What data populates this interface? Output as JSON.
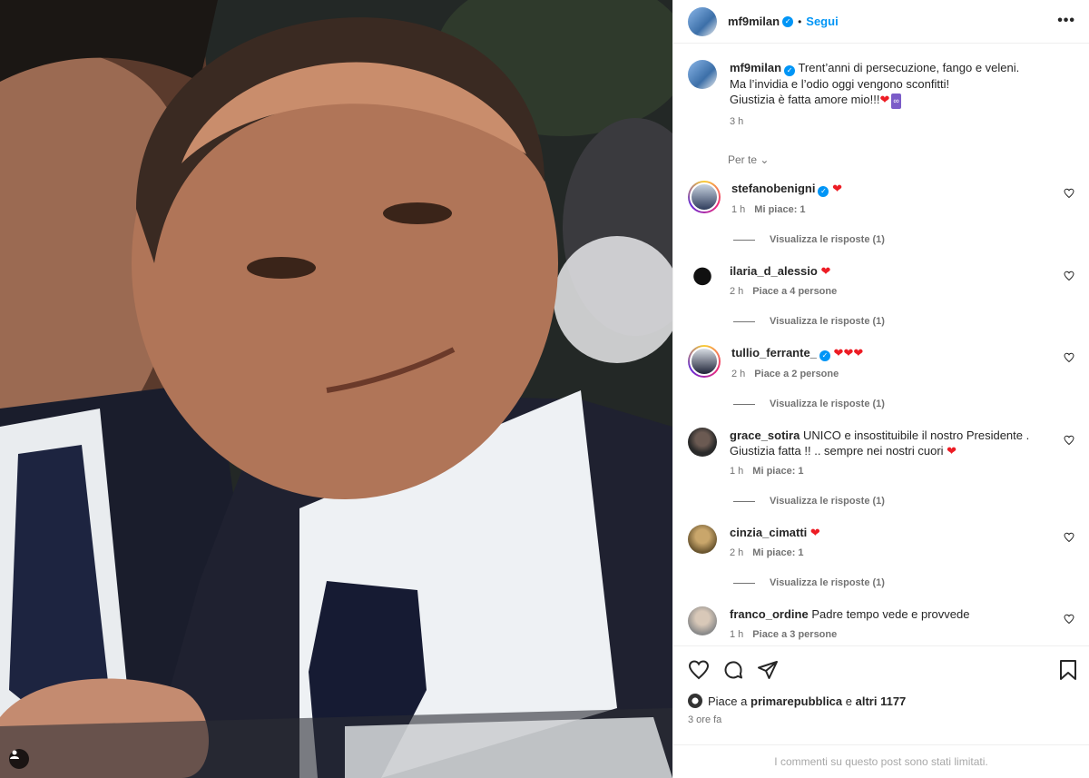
{
  "post": {
    "author": "mf9milan",
    "follow_label": "Segui",
    "more_label": "•••",
    "caption_line1": "Trent’anni di persecuzione, fango e veleni.",
    "caption_line2": "Ma l’invidia e l’odio oggi vengono sconfitti!",
    "caption_line3": "Giustizia è fatta amore mio!!!",
    "caption_time": "3 h",
    "for_you": "Per te"
  },
  "comments": [
    {
      "user": "stefanobenigni",
      "verified": true,
      "text": "",
      "hearts": 1,
      "time": "1 h",
      "likes": "Mi piace: 1",
      "replies": "Visualizza le risposte (1)"
    },
    {
      "user": "ilaria_d_alessio",
      "verified": false,
      "text": "",
      "hearts": 1,
      "time": "2 h",
      "likes": "Piace a 4 persone",
      "replies": "Visualizza le risposte (1)"
    },
    {
      "user": "tullio_ferrante_",
      "verified": true,
      "text": "",
      "hearts": 3,
      "time": "2 h",
      "likes": "Piace a 2 persone",
      "replies": "Visualizza le risposte (1)"
    },
    {
      "user": "grace_sotira",
      "verified": false,
      "text": "UNICO e insostituibile il nostro Presidente .",
      "text2": "Giustizia fatta !! .. sempre nei nostri cuori",
      "hearts": 1,
      "time": "1 h",
      "likes": "Mi piace: 1",
      "replies": "Visualizza le risposte (1)"
    },
    {
      "user": "cinzia_cimatti",
      "verified": false,
      "text": "",
      "hearts": 1,
      "time": "2 h",
      "likes": "Mi piace: 1",
      "replies": "Visualizza le risposte (1)"
    },
    {
      "user": "franco_ordine",
      "verified": false,
      "text": "Padre tempo vede e provvede",
      "hearts": 0,
      "time": "1 h",
      "likes": "Piace a 3 persone",
      "replies": ""
    }
  ],
  "likes": {
    "prefix": "Piace a",
    "user": "primarepubblica",
    "middle": "e",
    "others": "altri 1177"
  },
  "post_time": "3 ore fa",
  "limited_notice": "I commenti su questo post sono stati limitati.",
  "icons": [
    "heart-icon",
    "comment-icon",
    "share-icon",
    "bookmark-icon",
    "more-icon",
    "verified-icon",
    "chevron-down-icon",
    "tag-icon"
  ],
  "colors": {
    "accent": "#0095f6",
    "heart": "#ed1c24",
    "muted": "#737373"
  }
}
